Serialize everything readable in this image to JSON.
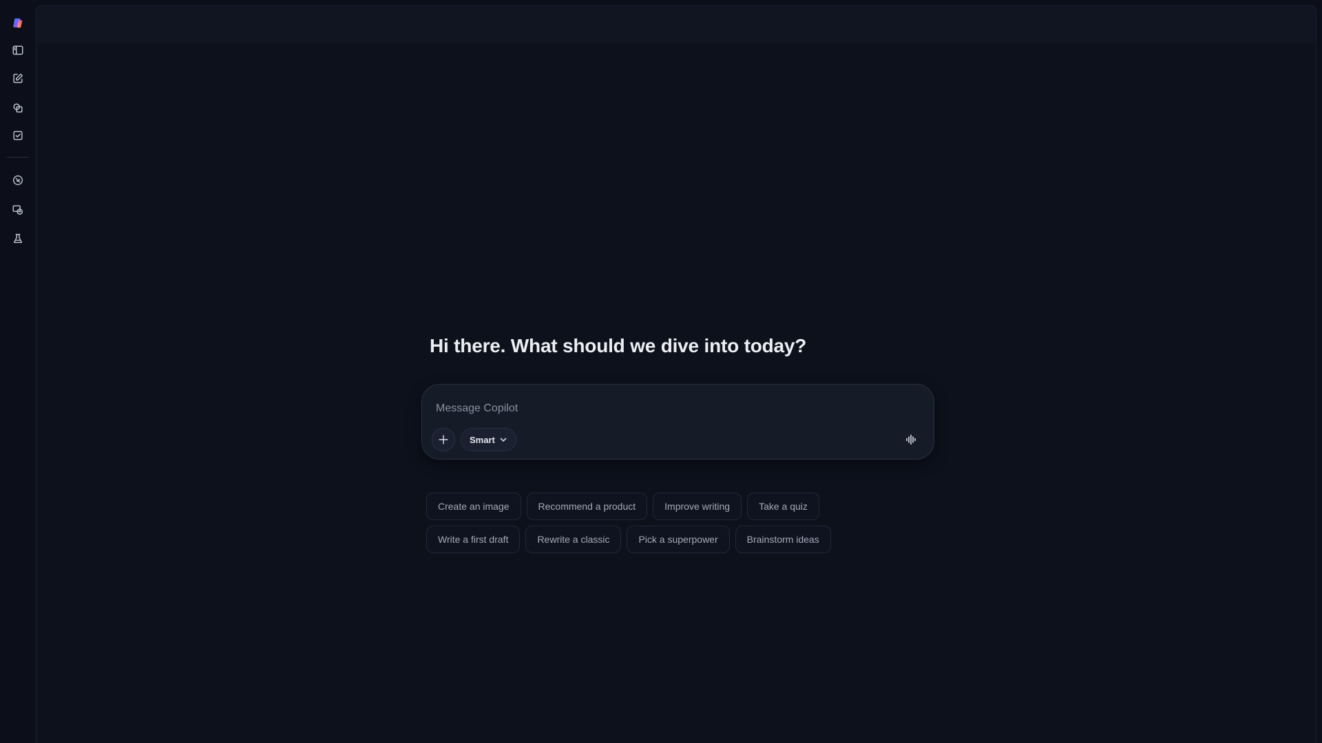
{
  "sidebar": {
    "items": [
      {
        "name": "copilot-logo-icon"
      },
      {
        "name": "sidebar-toggle-icon"
      },
      {
        "name": "new-chat-icon"
      },
      {
        "name": "library-icon"
      },
      {
        "name": "tasks-icon"
      },
      {
        "name": "discover-icon"
      },
      {
        "name": "conversations-icon"
      },
      {
        "name": "labs-icon"
      }
    ]
  },
  "main": {
    "greeting": "Hi there. What should we dive into today?",
    "composer": {
      "placeholder": "Message Copilot",
      "mode_label": "Smart"
    },
    "suggestions": {
      "row1": [
        "Create an image",
        "Recommend a product",
        "Improve writing",
        "Take a quiz"
      ],
      "row2": [
        "Write a first draft",
        "Rewrite a classic",
        "Pick a superpower",
        "Brainstorm ideas"
      ]
    }
  },
  "colors": {
    "background": "#0c0f1a",
    "panel": "#0d111c",
    "composer": "#161b28",
    "text_primary": "#eceef3",
    "text_muted": "#a4aab8"
  }
}
